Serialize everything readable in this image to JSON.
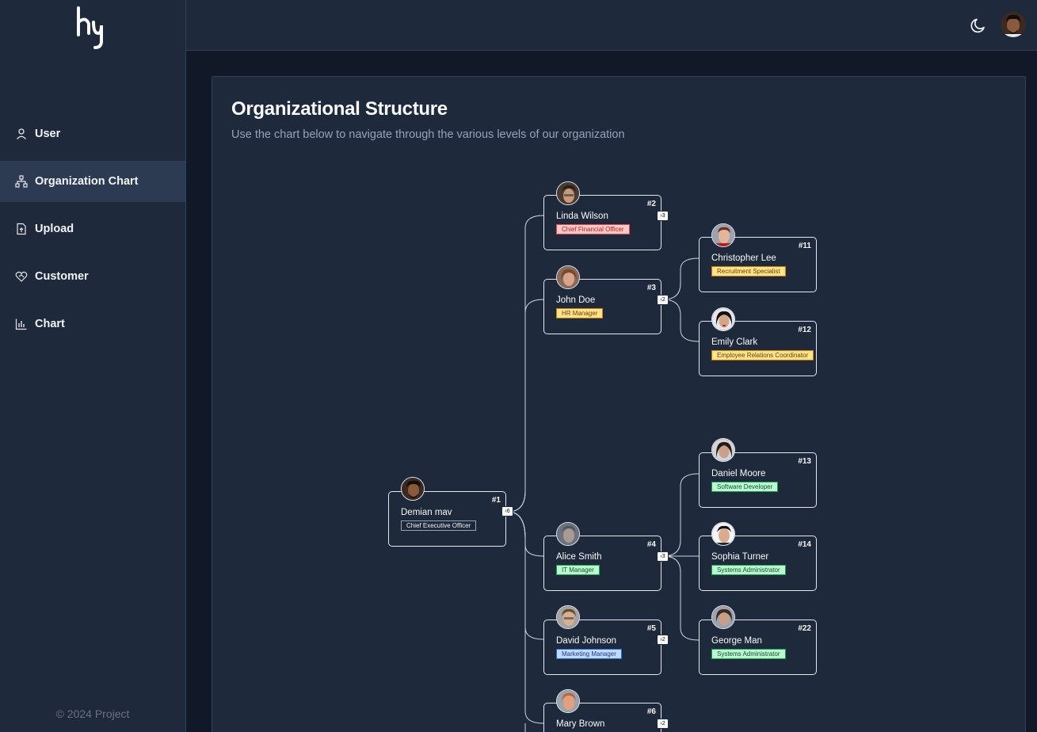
{
  "sidebar": {
    "nav": [
      {
        "label": "User",
        "icon": "user-icon",
        "active": false
      },
      {
        "label": "Organization Chart",
        "icon": "org-chart-icon",
        "active": true
      },
      {
        "label": "Upload",
        "icon": "upload-file-icon",
        "active": false
      },
      {
        "label": "Customer",
        "icon": "heart-handshake-icon",
        "active": false
      },
      {
        "label": "Chart",
        "icon": "bar-chart-icon",
        "active": false
      }
    ],
    "copyright": "© 2024 Project"
  },
  "header": {
    "theme_icon": "moon-icon",
    "avatar": "user-avatar"
  },
  "page": {
    "title": "Organizational Structure",
    "subtitle": "Use the chart below to navigate through the various levels of our organization"
  },
  "org": {
    "nodes": [
      {
        "id": "#1",
        "name": "Demian mav",
        "role": "Chief Executive Officer",
        "role_color": "#1e293b",
        "role_border": "#94a3b8",
        "role_text": "#f1f5f9",
        "toggle": "6",
        "skin": "#8a5a3c",
        "hair": "#1a1a1a"
      },
      {
        "id": "#2",
        "name": "Linda Wilson",
        "role": "Chief Financial Officer",
        "role_color": "#fecaca",
        "role_border": "#ef4444",
        "role_text": "#b91c1c",
        "toggle": "3",
        "skin": "#c89a7a",
        "hair": "#222"
      },
      {
        "id": "#3",
        "name": "John Doe",
        "role": "HR Manager",
        "role_color": "#fde68a",
        "role_border": "#d97706",
        "role_text": "#78350f",
        "toggle": "2",
        "skin": "#d9a58a",
        "hair": "#7a4a2c"
      },
      {
        "id": "#11",
        "name": "Christopher Lee",
        "role": "Recruitment Specialist",
        "role_color": "#fde68a",
        "role_border": "#d97706",
        "role_text": "#78350f",
        "toggle": "",
        "skin": "#e3b59a",
        "hair": "#6b2f1d"
      },
      {
        "id": "#12",
        "name": "Emily Clark",
        "role": "Employee Relations Coordinator",
        "role_color": "#fde68a",
        "role_border": "#d97706",
        "role_text": "#78350f",
        "toggle": "",
        "skin": "#d6a488",
        "hair": "#111"
      },
      {
        "id": "#13",
        "name": "Daniel Moore",
        "role": "Software Developer",
        "role_color": "#bbf7d0",
        "role_border": "#16a34a",
        "role_text": "#14532d",
        "toggle": "",
        "skin": "#caa08a",
        "hair": "#2b1a12"
      },
      {
        "id": "#4",
        "name": "Alice Smith",
        "role": "IT Manager",
        "role_color": "#bbf7d0",
        "role_border": "#16a34a",
        "role_text": "#14532d",
        "toggle": "3",
        "skin": "#a89c92",
        "hair": "#555"
      },
      {
        "id": "#14",
        "name": "Sophia Turner",
        "role": "Systems Administrator",
        "role_color": "#bbf7d0",
        "role_border": "#16a34a",
        "role_text": "#14532d",
        "toggle": "",
        "skin": "#d9ad8c",
        "hair": "#111"
      },
      {
        "id": "#5",
        "name": "David Johnson",
        "role": "Marketing Manager",
        "role_color": "#bfdbfe",
        "role_border": "#2563eb",
        "role_text": "#1e3a8a",
        "toggle": "2",
        "skin": "#d7b08e",
        "hair": "#6b4b2a"
      },
      {
        "id": "#22",
        "name": "George Man",
        "role": "Systems Administrator",
        "role_color": "#bbf7d0",
        "role_border": "#16a34a",
        "role_text": "#14532d",
        "toggle": "",
        "skin": "#c99e86",
        "hair": "#3a2a22"
      },
      {
        "id": "#6",
        "name": "Mary Brown",
        "role": "",
        "role_color": "#fde68a",
        "role_border": "#d97706",
        "role_text": "#78350f",
        "toggle": "2",
        "skin": "#e2a07c",
        "hair": "#b76a3a"
      }
    ]
  }
}
